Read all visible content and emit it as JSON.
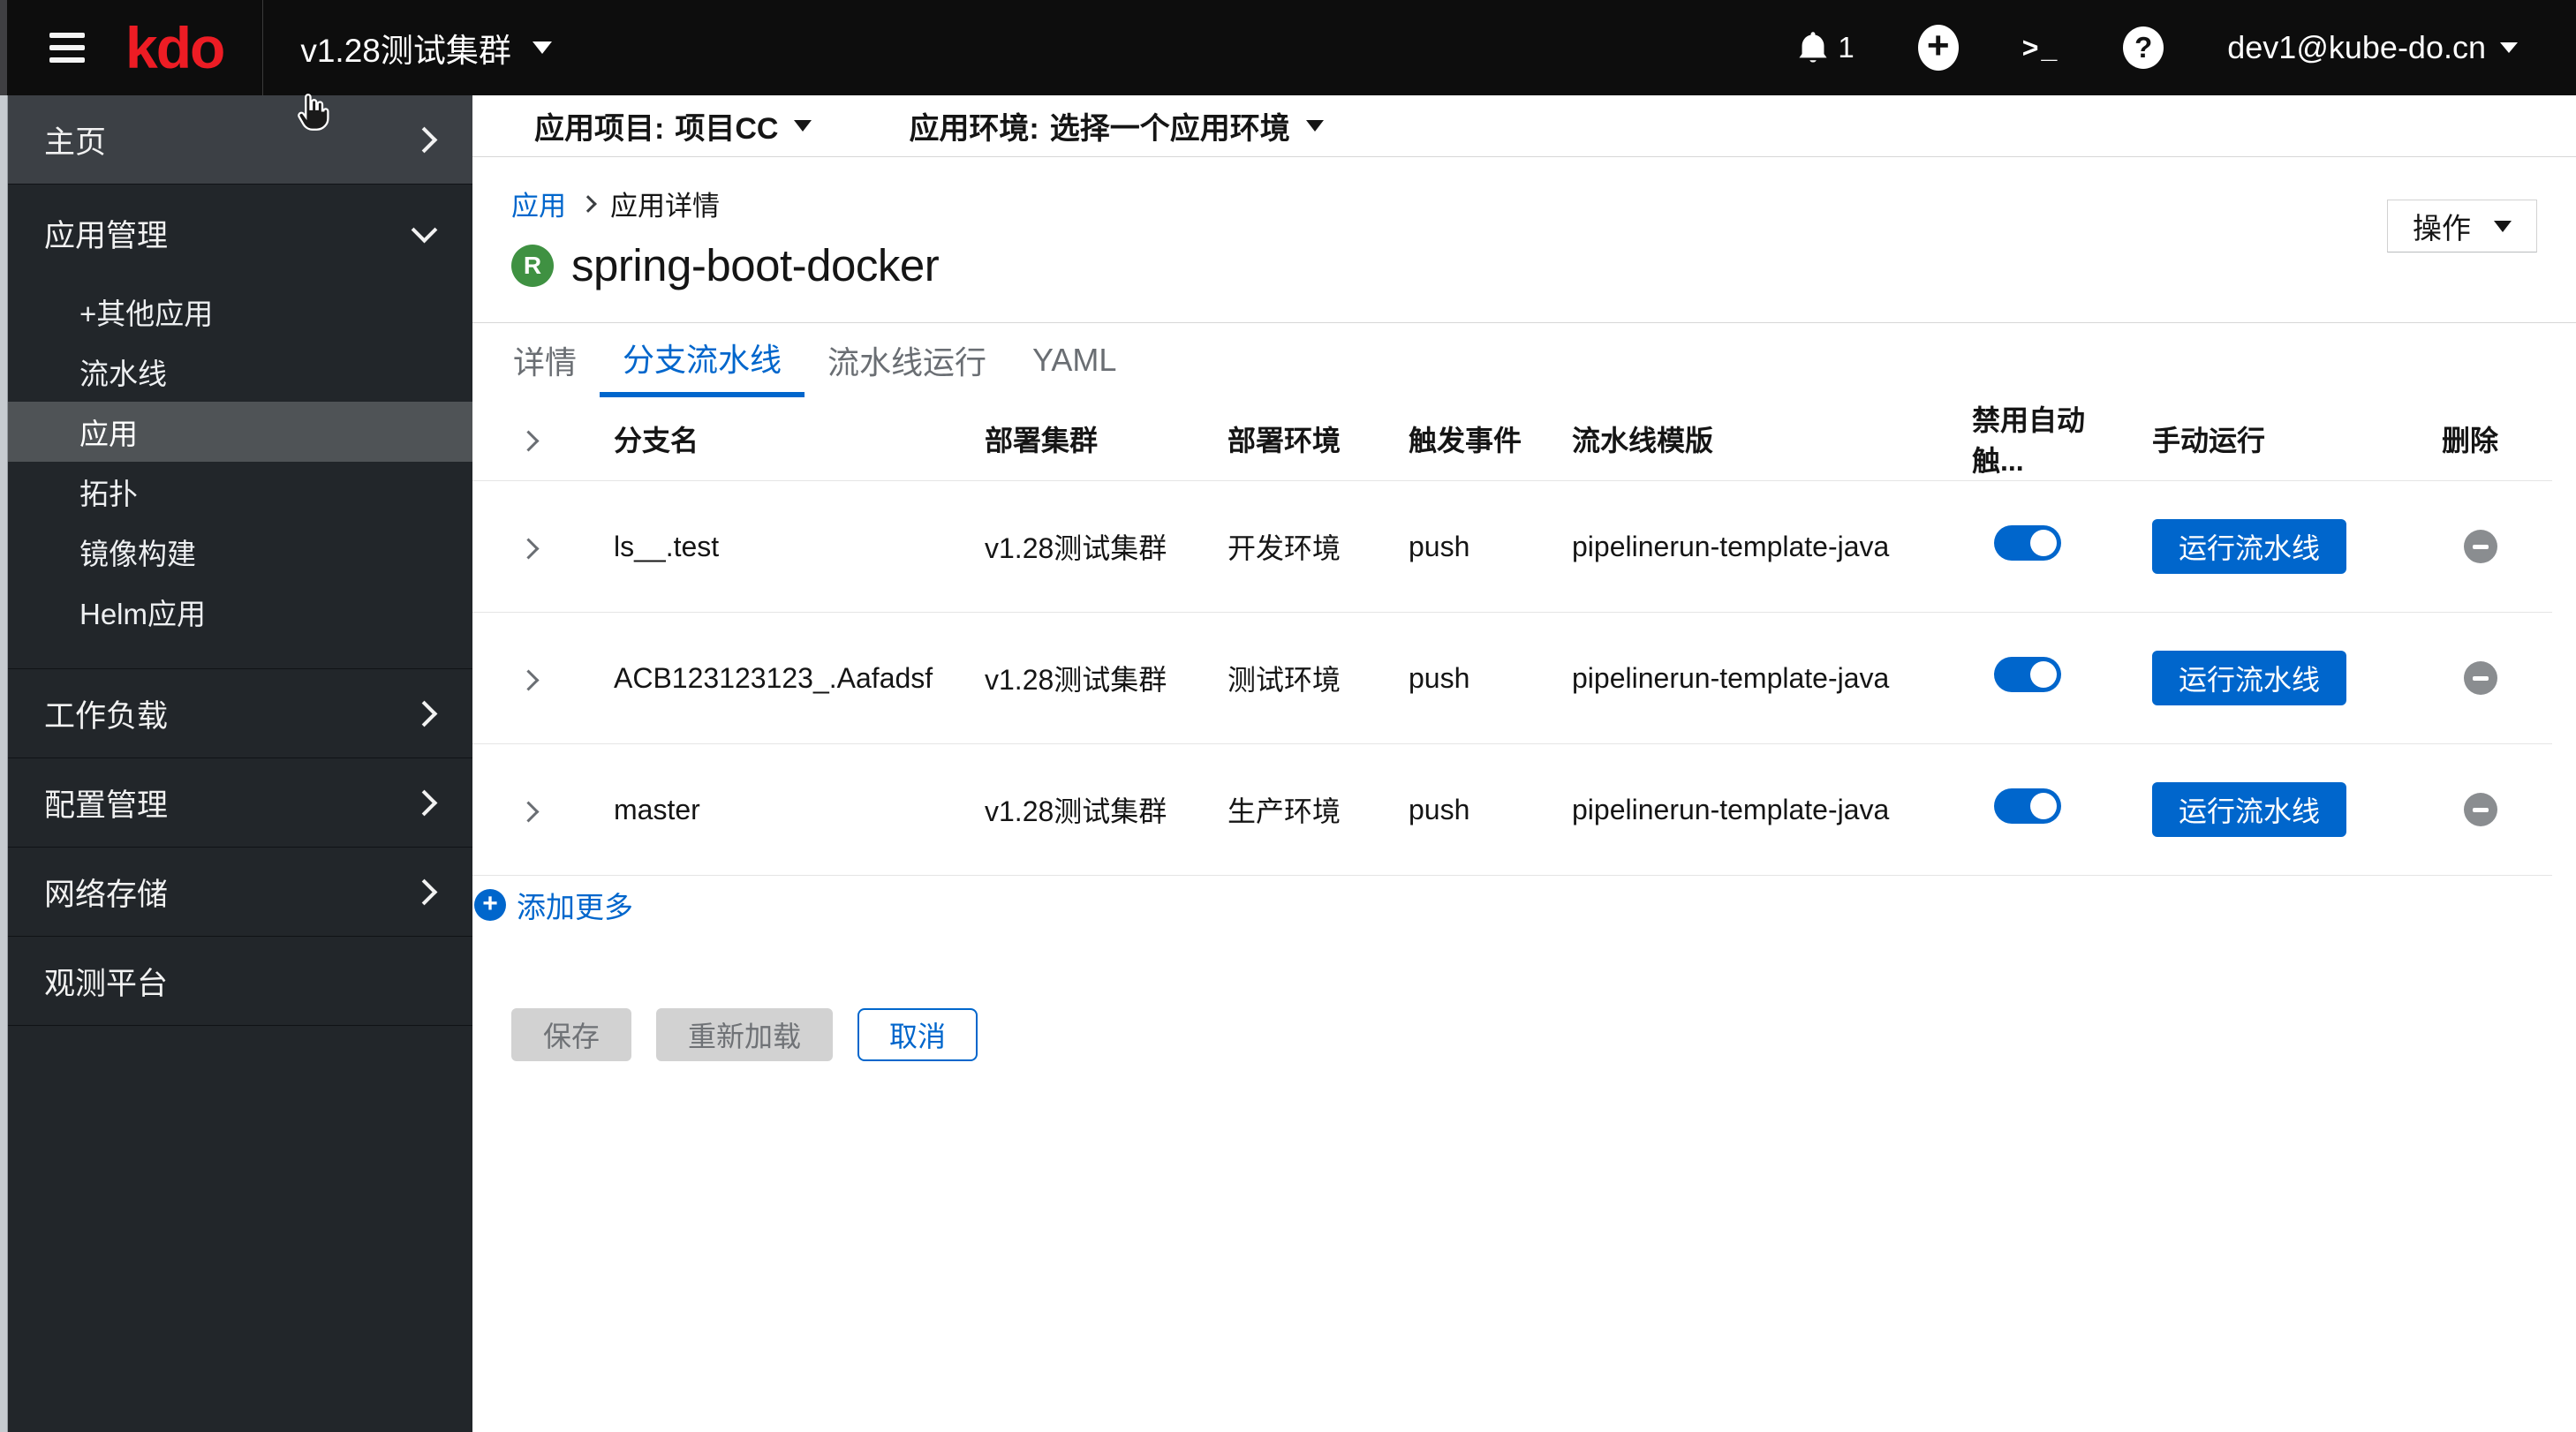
{
  "masthead": {
    "logo": "kdo",
    "cluster_selector": "v1.28测试集群",
    "notification_count": "1",
    "terminal_icon_text": ">_",
    "plus_icon_text": "+",
    "help_icon_text": "?",
    "user": "dev1@kube-do.cn"
  },
  "sidebar": {
    "home": "主页",
    "app_management": "应用管理",
    "sub_items": [
      "+其他应用",
      "流水线",
      "应用",
      "拓扑",
      "镜像构建",
      "Helm应用"
    ],
    "selected_sub_item": "应用",
    "workloads": "工作负载",
    "config_management": "配置管理",
    "network_storage": "网络存储",
    "observability": "观测平台"
  },
  "filterbar": {
    "project_label": "应用项目:",
    "project_value": "项目CC",
    "environment_label": "应用环境:",
    "environment_value": "选择一个应用环境"
  },
  "breadcrumb": {
    "items": [
      "应用",
      "应用详情"
    ]
  },
  "page": {
    "badge": "R",
    "title": "spring-boot-docker",
    "actions_label": "操作"
  },
  "tabs": [
    "详情",
    "分支流水线",
    "流水线运行",
    "YAML"
  ],
  "active_tab": "分支流水线",
  "table": {
    "headers": [
      "分支名",
      "部署集群",
      "部署环境",
      "触发事件",
      "流水线模版",
      "禁用自动触...",
      "手动运行",
      "删除"
    ],
    "rows": [
      {
        "branch": "ls__.test",
        "cluster": "v1.28测试集群",
        "environment": "开发环境",
        "trigger": "push",
        "template": "pipelinerun-template-java",
        "auto_trigger_disabled": true,
        "run_label": "运行流水线"
      },
      {
        "branch": "ACB123123123_.Aafadsf",
        "cluster": "v1.28测试集群",
        "environment": "测试环境",
        "trigger": "push",
        "template": "pipelinerun-template-java",
        "auto_trigger_disabled": true,
        "run_label": "运行流水线"
      },
      {
        "branch": "master",
        "cluster": "v1.28测试集群",
        "environment": "生产环境",
        "trigger": "push",
        "template": "pipelinerun-template-java",
        "auto_trigger_disabled": true,
        "run_label": "运行流水线"
      }
    ]
  },
  "add_more_label": "添加更多",
  "footer_buttons": {
    "save": "保存",
    "reload": "重新加载",
    "cancel": "取消"
  },
  "colors": {
    "primary_blue": "#0066cc",
    "logo_red": "#ed1c24",
    "badge_green": "#3f9142",
    "sidebar_selected_border": "#73bcf7",
    "masthead_bg": "#0d0d0d",
    "sidebar_bg": "#22262a"
  }
}
